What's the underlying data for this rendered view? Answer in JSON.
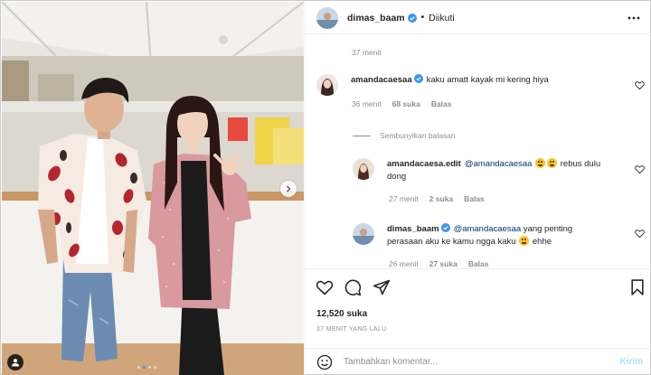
{
  "post": {
    "author": "dimas_baam",
    "dot": "•",
    "follow_status": "Diikuti",
    "carousel": {
      "total_slides": 4,
      "active_slide": 2
    }
  },
  "comments": {
    "previous_time": "37 menit",
    "items": [
      {
        "user": "amandacaesaa",
        "verified": true,
        "text": "kaku amatt kayak mi kering hiya",
        "time": "36 menit",
        "likes": "68 suka",
        "reply": "Balas"
      }
    ],
    "hide_replies_label": "Sembunyikan balasan",
    "replies": [
      {
        "user": "amandacaesa.edit",
        "verified": false,
        "mention": "@amandacaesaa",
        "text_after_emoji": "rebus dulu dong",
        "time": "27 menit",
        "likes": "2 suka",
        "reply": "Balas"
      },
      {
        "user": "dimas_baam",
        "verified": true,
        "mention": "@amandacaesaa",
        "text": "yang penting perasaan aku ke kamu ngga kaku",
        "text_after_emoji": "ehhe",
        "time": "26 menit",
        "likes": "27 suka",
        "reply": "Balas"
      }
    ]
  },
  "actions": {
    "icons": [
      "heart-icon",
      "comment-icon",
      "share-icon",
      "bookmark-icon"
    ],
    "likes": "12,520 suka",
    "time_ago": "37 MENIT YANG LALU"
  },
  "add_comment": {
    "placeholder": "Tambahkan komentar...",
    "post_label": "Kirim"
  },
  "colors": {
    "verified": "#3897f0",
    "post_button_disabled": "#b2dffc",
    "mention": "#00376b",
    "muted": "#8e8e8e"
  }
}
